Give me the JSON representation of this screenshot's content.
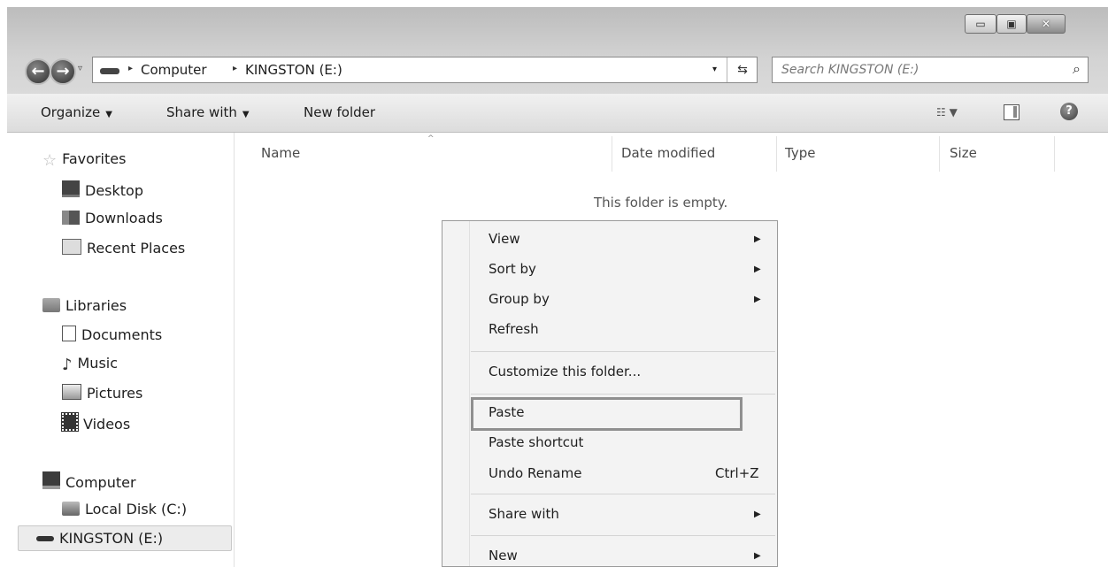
{
  "window": {
    "min_glyph": "▭",
    "max_glyph": "▣",
    "close_glyph": "✕"
  },
  "nav_buttons": {
    "back_glyph": "←",
    "forward_glyph": "→",
    "recent_glyph": "▿"
  },
  "address": {
    "crumbs": [
      "Computer",
      "KINGSTON (E:)"
    ],
    "separator": "▸",
    "dropdown_glyph": "▾",
    "refresh_glyph": "⇆"
  },
  "search": {
    "placeholder": "Search KINGSTON (E:)",
    "icon_glyph": "⌕"
  },
  "toolbar": {
    "organize": "Organize",
    "share_with": "Share with",
    "new_folder": "New folder",
    "caret": "▼",
    "views_glyph": "☷ ▼",
    "help_glyph": "?"
  },
  "nav": {
    "favorites": "Favorites",
    "desktop": "Desktop",
    "downloads": "Downloads",
    "recent_places": "Recent Places",
    "libraries": "Libraries",
    "documents": "Documents",
    "music": "Music",
    "pictures": "Pictures",
    "videos": "Videos",
    "computer": "Computer",
    "local_disk": "Local Disk (C:)",
    "kingston": "KINGSTON (E:)",
    "star_glyph": "☆",
    "note_glyph": "♪"
  },
  "columns": {
    "name": "Name",
    "date_modified": "Date modified",
    "type": "Type",
    "size": "Size",
    "sort_glyph": "^"
  },
  "content": {
    "empty_text": "This folder is empty."
  },
  "context_menu": {
    "view": "View",
    "sort_by": "Sort by",
    "group_by": "Group by",
    "refresh": "Refresh",
    "customize": "Customize this folder...",
    "paste": "Paste",
    "paste_shortcut": "Paste shortcut",
    "undo_rename": "Undo Rename",
    "undo_hotkey": "Ctrl+Z",
    "share_with": "Share with",
    "new": "New",
    "submenu_glyph": "▶"
  },
  "colors": {
    "chrome": "#d3d3d3",
    "menu_bg": "#f3f3f3",
    "highlight_border": "#8f8f8f"
  }
}
